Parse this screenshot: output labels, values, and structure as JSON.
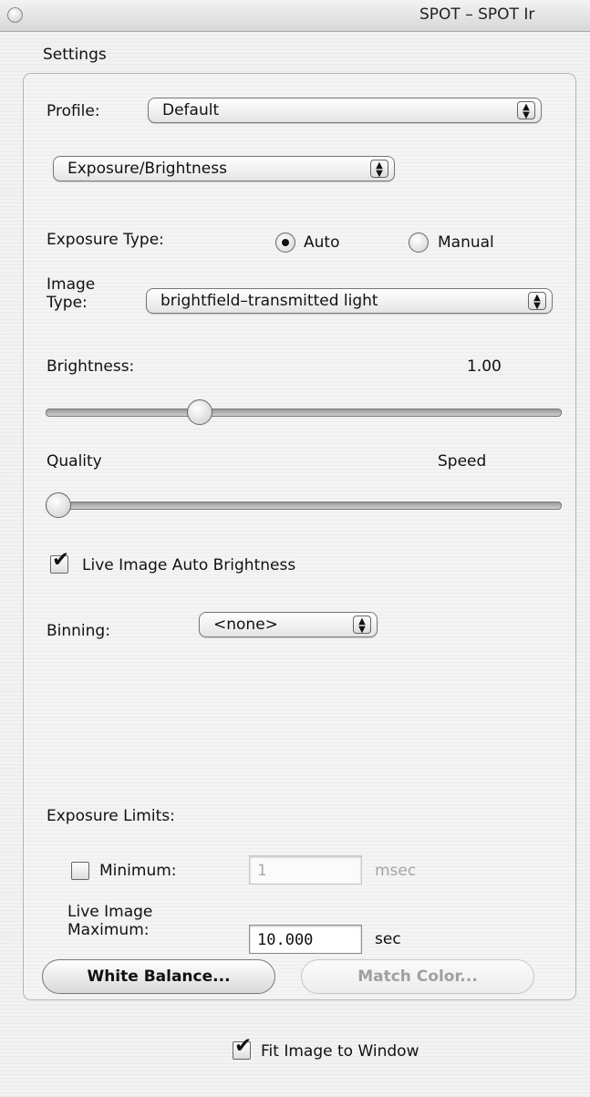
{
  "window": {
    "title": "SPOT – SPOT Ir"
  },
  "settings": {
    "group_label": "Settings",
    "profile": {
      "label": "Profile:",
      "value": "Default"
    },
    "category": {
      "value": "Exposure/Brightness"
    },
    "exposure_type": {
      "label": "Exposure Type:",
      "auto_label": "Auto",
      "manual_label": "Manual",
      "selected": "Auto"
    },
    "image_type": {
      "label_line1": "Image",
      "label_line2": "Type:",
      "value": "brightfield–transmitted light"
    },
    "brightness": {
      "label": "Brightness:",
      "value": "1.00",
      "slider_fraction": 0.29
    },
    "quality_speed": {
      "left_label": "Quality",
      "right_label": "Speed",
      "slider_fraction": 0.0
    },
    "live_auto_brightness": {
      "label": "Live Image Auto Brightness",
      "checked": true
    },
    "binning": {
      "label": "Binning:",
      "value": "<none>"
    },
    "exposure_limits": {
      "label": "Exposure Limits:",
      "minimum": {
        "label": "Minimum:",
        "value": "1",
        "unit": "msec",
        "checked": false
      },
      "maximum": {
        "label_line1": "Live Image",
        "label_line2": "Maximum:",
        "value": "10.000",
        "unit": "sec"
      }
    },
    "buttons": {
      "white_balance": "White Balance...",
      "match_color": "Match Color..."
    }
  },
  "fit_image": {
    "label": "Fit Image to Window",
    "checked": true
  },
  "icons": {
    "check": "✔",
    "popup_arrows": "▲▼"
  }
}
